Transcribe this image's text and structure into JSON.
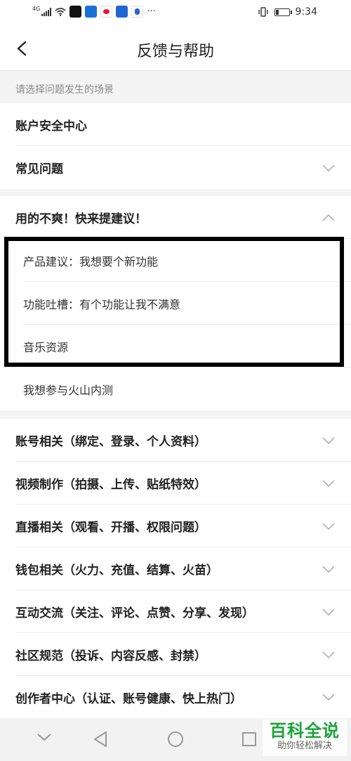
{
  "status_bar": {
    "network": "4G",
    "time": "9:34",
    "more": "···"
  },
  "header": {
    "title": "反馈与帮助"
  },
  "hint": "请选择问题发生的场景",
  "rows": [
    {
      "label": "账户安全中心",
      "chevron": "none"
    },
    {
      "label": "常见问题",
      "chevron": "down"
    },
    {
      "label": "用的不爽！快来提建议！",
      "chevron": "up"
    },
    {
      "label": "产品建议：我想要个新功能",
      "chevron": "none"
    },
    {
      "label": "功能吐槽：有个功能让我不满意",
      "chevron": "none"
    },
    {
      "label": "音乐资源",
      "chevron": "none"
    },
    {
      "label": "我想参与火山内测",
      "chevron": "none"
    },
    {
      "label": "账号相关（绑定、登录、个人资料）",
      "chevron": "down"
    },
    {
      "label": "视频制作（拍摄、上传、贴纸特效）",
      "chevron": "down"
    },
    {
      "label": "直播相关（观看、开播、权限问题）",
      "chevron": "down"
    },
    {
      "label": "钱包相关（火力、充值、结算、火苗）",
      "chevron": "down"
    },
    {
      "label": "互动交流（关注、评论、点赞、分享、发现）",
      "chevron": "down"
    },
    {
      "label": "社区规范（投诉、内容反感、封禁）",
      "chevron": "down"
    },
    {
      "label": "创作者中心（认证、账号健康、快上热门）",
      "chevron": "down"
    }
  ],
  "watermark": {
    "main": "百科全说",
    "sub": "助你轻松解决"
  },
  "colors": {
    "watermark": "#1aa33a",
    "highlight_border": "#000000"
  }
}
